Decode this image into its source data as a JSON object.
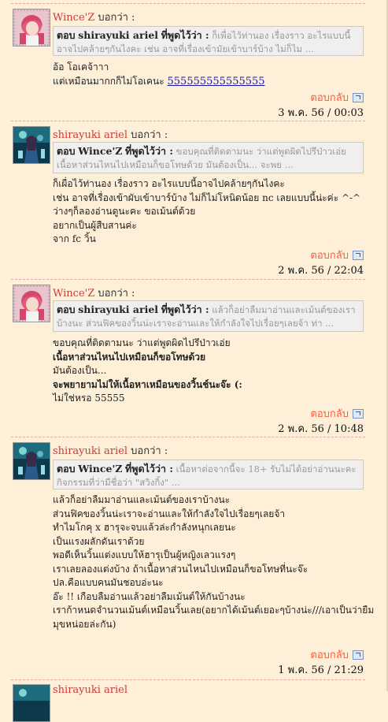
{
  "said_label": "บอกว่า :",
  "quote_said": "ที่พูดไว้ว่า :",
  "quote_prefix": "ตอบ",
  "reply_label": "ตอบกลับ",
  "colors": {
    "background": "#fdefd8",
    "author": "#d03b3b",
    "reply": "#ff5a3d",
    "link": "#1a1aaa"
  },
  "posts": [
    {
      "author": "Wince'Z",
      "quote_author": "shirayuki ariel",
      "quote_text": "ก็เพื่อไว้ท่านอง เรื่องราว อะไรแบบนี้อาจไปคล้ายๆกันไงคะ เช่น อาจที่เรื่องเข้ามัยเข้าบาร์บ้าง ไม่ก็ไม ...",
      "lines": [
        "อ้อ โอเคจ้าาา",
        "แต่เหมือนมากกก็ไม่โอเคนะ"
      ],
      "link": "555555555555555",
      "date": "3 พ.ค. 56 / 00:03"
    },
    {
      "author": "shirayuki ariel",
      "quote_author": "Wince'Z",
      "quote_text": "ขอบคุณที่ติดตามนะ ว่าแต่พูดผิดไปรึป่าวเอ่ย เนื้อหาส่วนไหนไปเหมือนก็ขอโทษด้วย มันต้องเป็น... จะพย ...",
      "lines": [
        "ก็เผื่อไว้ท่านอง เรื่องราว อะไรแบบนี้อาจไปคล้ายๆกันไงคะ",
        "เช่น อาจที่เรื่องเข้าผับเข้าบาร์บ้าง ไม่ก็ไม่โหนิดน้อย nc เลยแบบนี้น่ะค่ะ ^-^",
        "ว่างๆก็ลองอ่านดูนะคะ ขอเม้นต์ด้วย",
        "อยากเป็นผู้สืบสานค่ะ",
        "จาก fc วิ้น"
      ],
      "date": "2 พ.ค. 56 / 22:04"
    },
    {
      "author": "Wince'Z",
      "quote_author": "shirayuki ariel",
      "quote_text": "แล้วก็อย่าลืมมาอ่านและเม้นต์ของเราบ้างนะ ส่วนฟิคของวิ้นน่ะเราจะอ่านและให้กำลังใจไปเรื่อยๆเลยจ้า ท่า ...",
      "lines": [
        "ขอบคุณที่ติดตามนะ ว่าแต่พูดผิดไปรึป่าวเอ่ย",
        "เนื้อหาส่วนไหนไปเหมือนก็ขอโทษด้วย",
        "มันต้องเป็น...",
        "จะพยายามไม่ให้เนื้อหาเหมือนของวิ้นช์นะจ๊ะ (:",
        "ไม่ใช่หรอ 55555"
      ],
      "bold_lines": [
        1,
        3
      ],
      "date": "2 พ.ค. 56 / 10:48"
    },
    {
      "author": "shirayuki ariel",
      "quote_author": "Wince'Z",
      "quote_text": "เนื้อหาต่อจากนี้จะ 18+ รับไม่ได้อย่าอ่านนะคะ กิจกรรมที่ว่ามีชื่อว่า \"สวิงกิ้ง\" ...",
      "lines": [
        "แล้วก็อย่าลืมมาอ่านและเม้นต์ของเราบ้างนะ",
        "ส่วนฟิคของวิ้นน่ะเราจะอ่านและให้กำลังใจไปเรื่อยๆเลยจ้า",
        "ทำไมโกคุ x ฮารุจะจบแล้วล่ะกำลังหนุกเลยนะ",
        "เป็นแรงผลักดันเราด้วย",
        "พอดีเห็นวิ้นแต่งแบบให้ฮารุเป็นผู้หญิงเลวแรงๆ",
        "เราเลยลองแต่งบ้าง ถ้าเนื้อหาส่วนไหนไปเหมือนก็ขอโทษที่นะจ๊ะ",
        "ปล.คือแบบคนมันชอบอ่ะนะ",
        "อ๊ะ !! เกือบลืมอ่านแล้วอย่าลืมเม้นต์ให้กันบ้างนะ",
        "เราก้าหนดจำนวนเม้นต์เหมือนวิ้นเลย(อยากได้เม้นต์เยอะๆบ้างน่ะ///เอาเป็นว่ายืม",
        "มุขหน่อยล่ะกัน)"
      ],
      "date": "1 พ.ค. 56 / 21:29"
    }
  ],
  "tail_author": "shirayuki ariel"
}
